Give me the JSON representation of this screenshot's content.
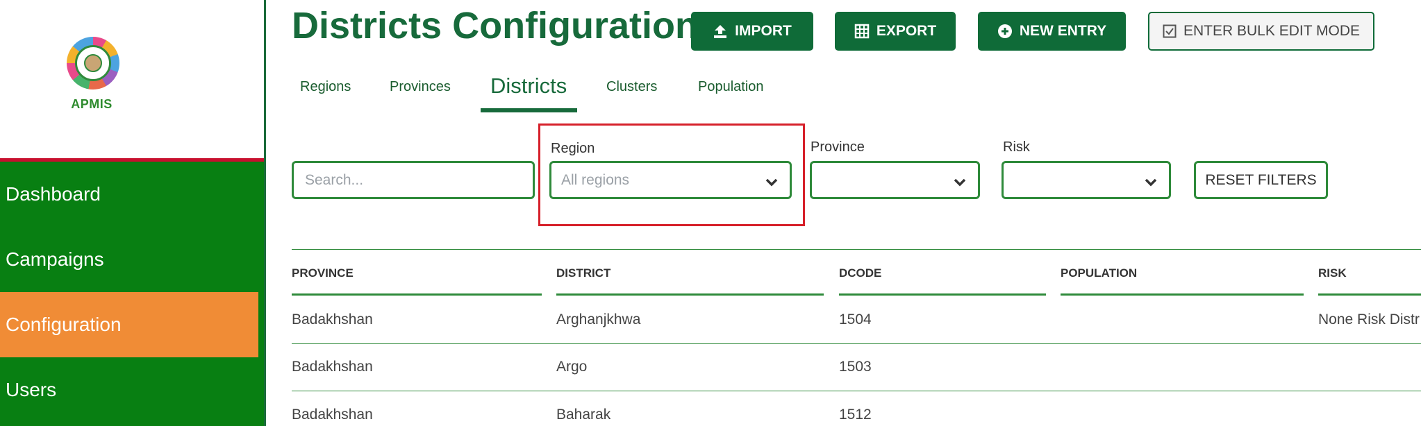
{
  "app": {
    "logo_text": "APMIS"
  },
  "sidebar": {
    "items": [
      {
        "label": "Dashboard"
      },
      {
        "label": "Campaigns"
      },
      {
        "label": "Configuration"
      },
      {
        "label": "Users"
      }
    ],
    "active_item": "Configuration"
  },
  "header": {
    "title": "Districts Configuration",
    "buttons": {
      "import": "IMPORT",
      "export": "EXPORT",
      "new_entry": "NEW ENTRY",
      "bulk_edit": "ENTER BULK EDIT MODE"
    }
  },
  "tabs": [
    {
      "label": "Regions"
    },
    {
      "label": "Provinces"
    },
    {
      "label": "Districts"
    },
    {
      "label": "Clusters"
    },
    {
      "label": "Population"
    }
  ],
  "active_tab": "Districts",
  "filters": {
    "search_placeholder": "Search...",
    "region": {
      "label": "Region",
      "placeholder": "All regions"
    },
    "province": {
      "label": "Province",
      "value": ""
    },
    "risk": {
      "label": "Risk",
      "value": ""
    },
    "reset_label": "RESET FILTERS"
  },
  "table": {
    "columns": [
      "PROVINCE",
      "DISTRICT",
      "DCODE",
      "POPULATION",
      "RISK"
    ],
    "rows": [
      {
        "province": "Badakhshan",
        "district": "Arghanjkhwa",
        "dcode": "1504",
        "population": "",
        "risk": "None Risk Distr"
      },
      {
        "province": "Badakhshan",
        "district": "Argo",
        "dcode": "1503",
        "population": "",
        "risk": ""
      },
      {
        "province": "Badakhshan",
        "district": "Baharak",
        "dcode": "1512",
        "population": "",
        "risk": ""
      }
    ]
  },
  "colors": {
    "brand_green": "#176a3b",
    "sidebar_green": "#087f12",
    "active_orange": "#f08c36",
    "highlight_red": "#d6202a"
  }
}
